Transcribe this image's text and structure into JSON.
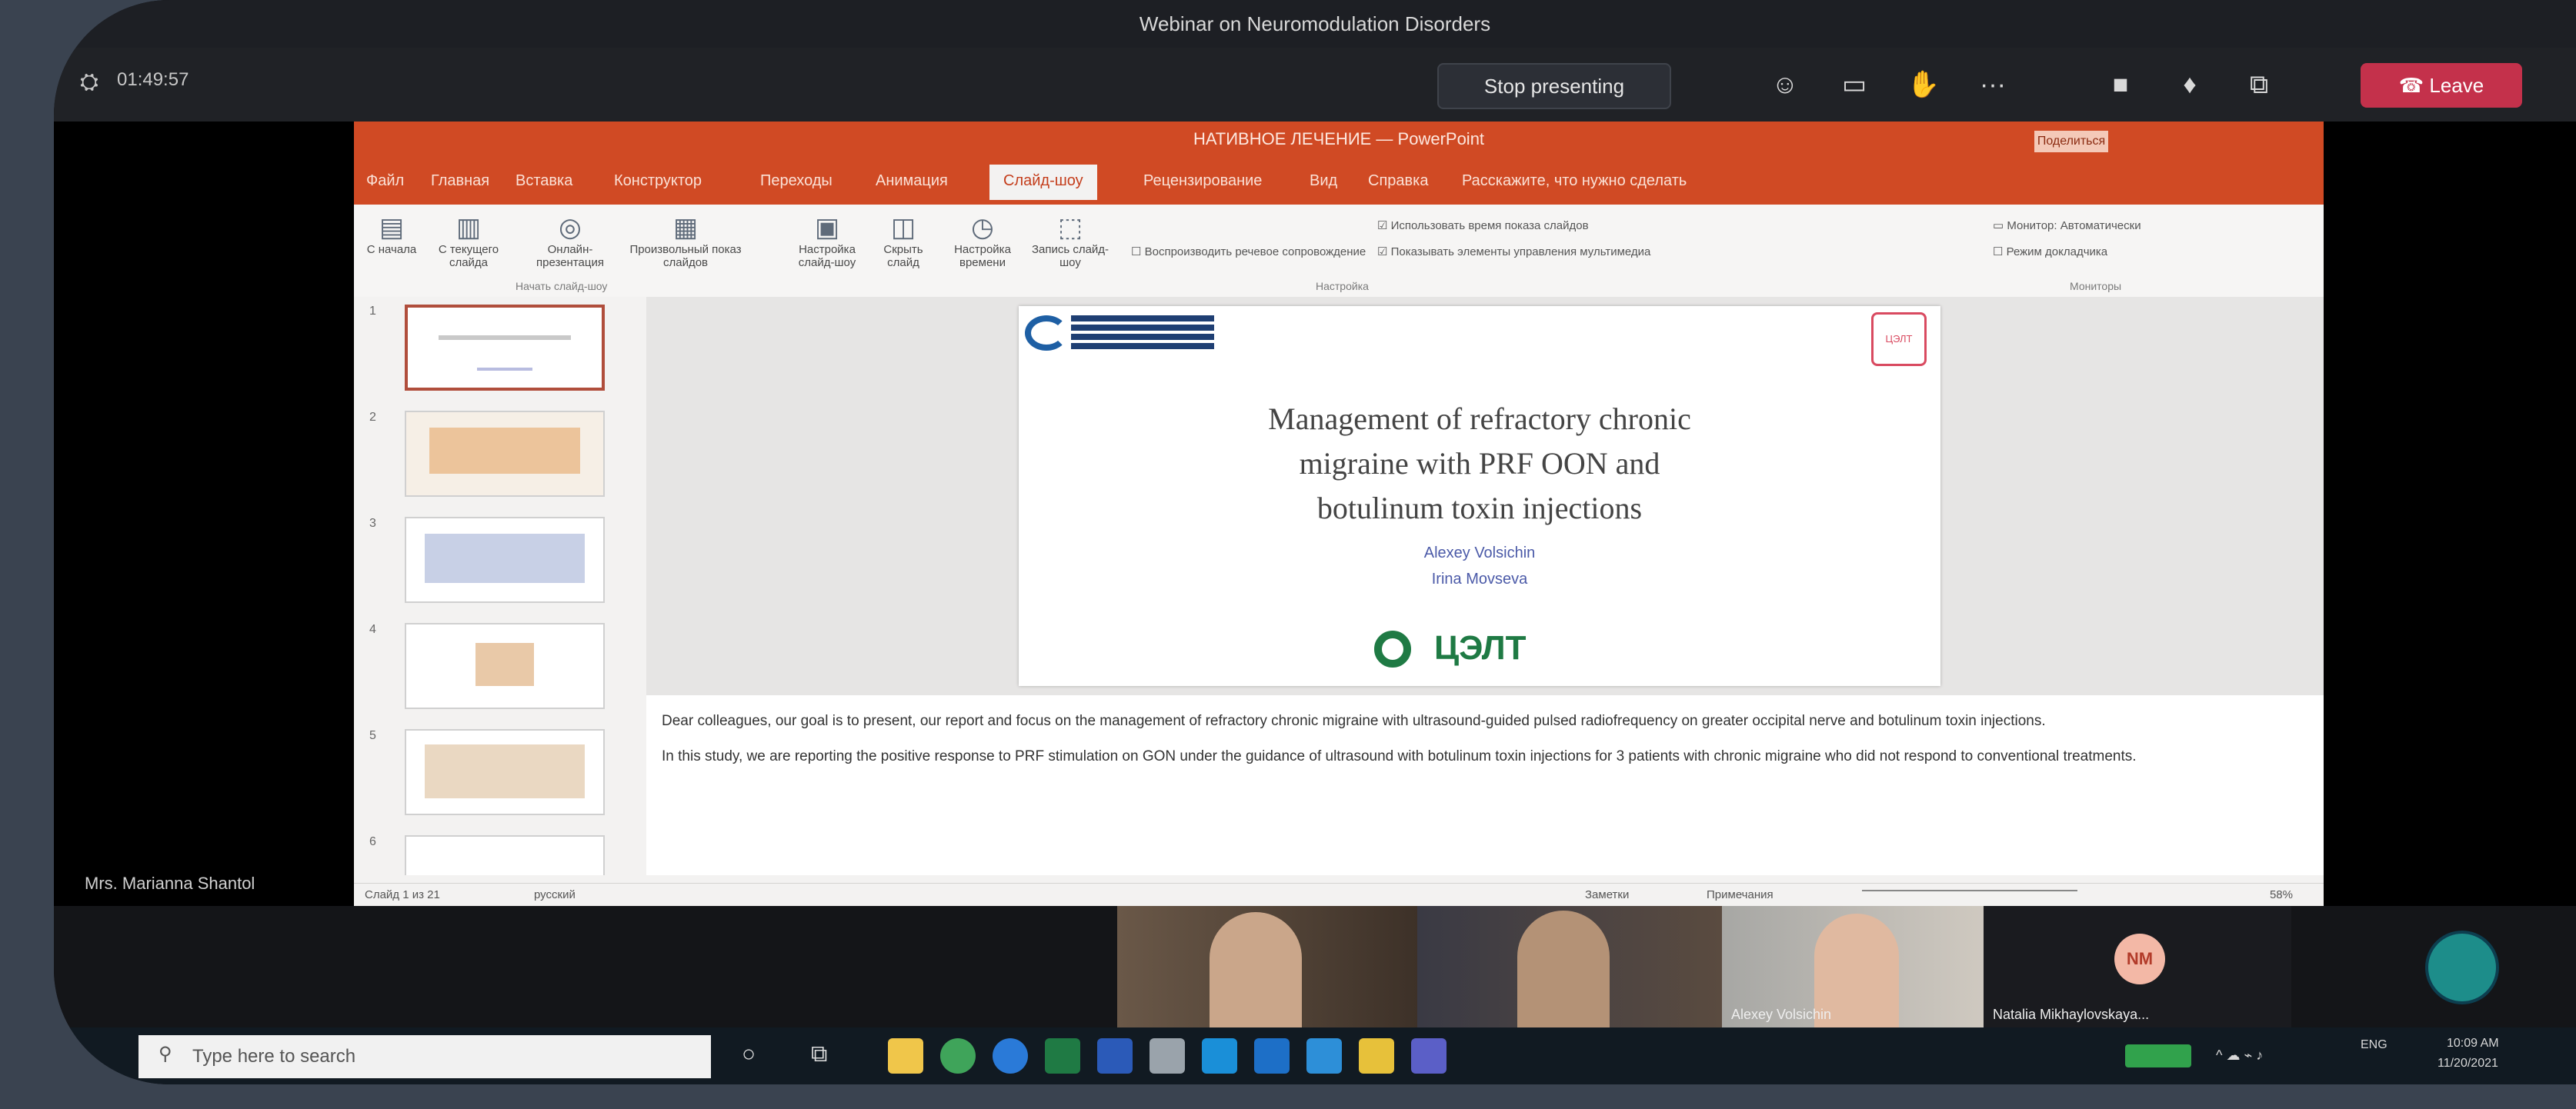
{
  "window": {
    "title": "Webinar on Neuromodulation Disorders"
  },
  "teams": {
    "timer": "01:49:57",
    "stop_sharing": "Stop presenting",
    "leave": "Leave",
    "presenter_name": "Mrs. Marianna Shantol"
  },
  "ppt": {
    "title": "НАТИВНОЕ ЛЕЧЕНИЕ — PowerPoint",
    "share_label": "Поделиться",
    "tabs": [
      "Файл",
      "Главная",
      "Вставка",
      "Конструктор",
      "Переходы",
      "Анимация",
      "Слайд-шоу",
      "Рецензирование",
      "Вид",
      "Справка",
      "Расскажите, что нужно сделать"
    ],
    "active_tab": "Слайд-шоу",
    "ribbon_buttons": [
      {
        "label": "С начала"
      },
      {
        "label": "С текущего слайда"
      },
      {
        "label": "Онлайн-презентация"
      },
      {
        "label": "Произвольный показ слайдов"
      },
      {
        "label": "Настройка слайд-шоу"
      },
      {
        "label": "Скрыть слайд"
      },
      {
        "label": "Настройка времени"
      },
      {
        "label": "Запись слайд-шоу"
      }
    ],
    "ribbon_checks": [
      "Воспроизводить речевое сопровождение",
      "Использовать время показа слайдов",
      "Показывать элементы управления мультимедиа",
      "Режим докладчика",
      "Монитор: Автоматически"
    ],
    "ribbon_groups": [
      "Начать слайд-шоу",
      "Настройка",
      "Мониторы"
    ],
    "slide_numbers": [
      "1",
      "2",
      "3",
      "4",
      "5",
      "6"
    ],
    "slide": {
      "title_lines": [
        "Management of refractory chronic",
        "migraine with PRF OON and",
        "botulinum toxin injections"
      ],
      "authors": [
        "Alexey Volsichin",
        "Irina Movseva"
      ],
      "logo": "ЦЭЛТ",
      "corner_logo": "ЦЭЛТ"
    },
    "notes": [
      "Dear colleagues, our goal is to present, our report and focus on the management of refractory chronic migraine with ultrasound-guided pulsed radiofrequency on greater occipital nerve and botulinum toxin injections.",
      "In this study, we are reporting the positive response to PRF stimulation on GON under the guidance of ultrasound with botulinum toxin injections for 3 patients with chronic migraine who did not respond to conventional treatments."
    ],
    "status_left": "Слайд 1 из 21",
    "status_lang": "русский",
    "status_notes": "Заметки",
    "status_comments": "Примечания",
    "zoom": "58%"
  },
  "participants": [
    {
      "name": ""
    },
    {
      "name": ""
    },
    {
      "name": "Alexey Volsichin"
    },
    {
      "name": "Natalia Mikhaylovskaya..."
    }
  ],
  "participant_initials": "NM",
  "taskbar": {
    "search_placeholder": "Type here to search",
    "tray_lang": "ENG",
    "time": "10:09 AM",
    "date": "11/20/2021"
  },
  "colors": {
    "ppt_accent": "#d04a24",
    "leave_red": "#c4314b"
  }
}
